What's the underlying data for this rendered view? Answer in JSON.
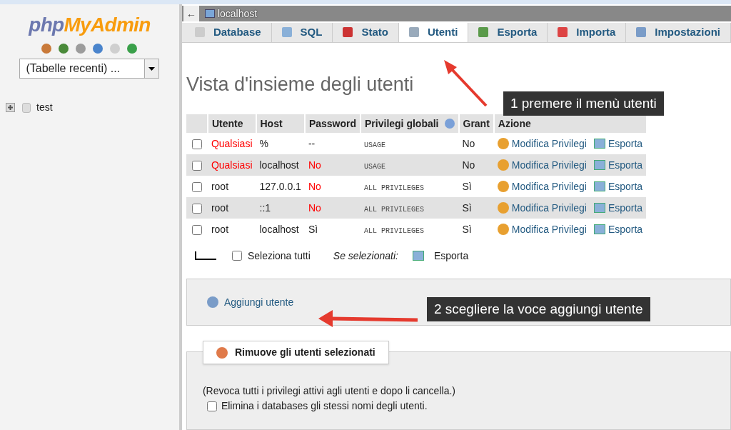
{
  "sidebar": {
    "logo_php": "php",
    "logo_main": "MyAdmin",
    "recent_tables": "(Tabelle recenti) ...",
    "tree": [
      {
        "label": "test",
        "expanded": false
      }
    ]
  },
  "breadcrumb": {
    "back": "←",
    "server": "localhost"
  },
  "tabs": [
    {
      "label": "Database",
      "selected": false
    },
    {
      "label": "SQL",
      "selected": false
    },
    {
      "label": "Stato",
      "selected": false
    },
    {
      "label": "Utenti",
      "selected": true
    },
    {
      "label": "Esporta",
      "selected": false
    },
    {
      "label": "Importa",
      "selected": false
    },
    {
      "label": "Impostazioni",
      "selected": false
    }
  ],
  "heading": "Vista d'insieme degli utenti",
  "table": {
    "columns": [
      "Utente",
      "Host",
      "Password",
      "Privilegi globali",
      "Grant",
      "Azione"
    ],
    "rows": [
      {
        "checked": false,
        "user": "Qualsiasi",
        "user_warn": true,
        "host": "%",
        "password": "--",
        "password_warn": false,
        "privileges": "USAGE",
        "grant": "No",
        "edit": "Modifica Privilegi",
        "export": "Esporta"
      },
      {
        "checked": false,
        "user": "Qualsiasi",
        "user_warn": true,
        "host": "localhost",
        "password": "No",
        "password_warn": true,
        "privileges": "USAGE",
        "grant": "No",
        "edit": "Modifica Privilegi",
        "export": "Esporta"
      },
      {
        "checked": false,
        "user": "root",
        "user_warn": false,
        "host": "127.0.0.1",
        "password": "No",
        "password_warn": true,
        "privileges": "ALL PRIVILEGES",
        "grant": "Sì",
        "edit": "Modifica Privilegi",
        "export": "Esporta"
      },
      {
        "checked": false,
        "user": "root",
        "user_warn": false,
        "host": "::1",
        "password": "No",
        "password_warn": true,
        "privileges": "ALL PRIVILEGES",
        "grant": "Sì",
        "edit": "Modifica Privilegi",
        "export": "Esporta"
      },
      {
        "checked": false,
        "user": "root",
        "user_warn": false,
        "host": "localhost",
        "password": "Sì",
        "password_warn": false,
        "privileges": "ALL PRIVILEGES",
        "grant": "Sì",
        "edit": "Modifica Privilegi",
        "export": "Esporta"
      }
    ]
  },
  "bulk": {
    "select_all": "Seleziona tutti",
    "select_all_checked": false,
    "with_selected": "Se selezionati:",
    "export": "Esporta"
  },
  "add_user": "Aggiungi utente",
  "remove": {
    "legend": "Rimuove gli utenti selezionati",
    "note": "(Revoca tutti i privilegi attivi agli utenti e dopo li cancella.)",
    "drop_db": "Elimina i databases gli stessi nomi degli utenti.",
    "drop_db_checked": false
  },
  "annotations": [
    "1 premere il menù utenti",
    "2 scegliere la voce aggiungi utente"
  ]
}
